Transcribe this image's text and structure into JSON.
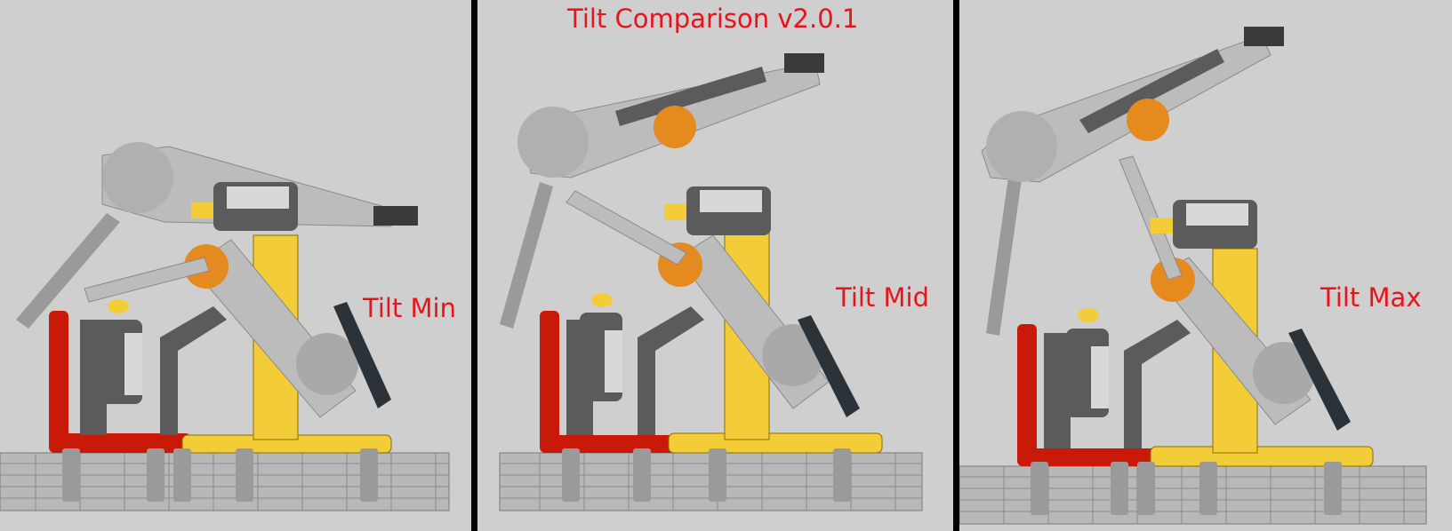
{
  "title": "Tilt Comparison v2.0.1",
  "panels": [
    {
      "label": "Tilt Min"
    },
    {
      "label": "Tilt Mid"
    },
    {
      "label": "Tilt Max"
    }
  ],
  "colors": {
    "background": "#cfcfcf",
    "label": "#e8141c",
    "divider": "#000000",
    "yellow_beam": "#f2cd37",
    "red_beam": "#c91a09",
    "light_gray": "#bcbcbc",
    "dark_gray": "#5b5b5b",
    "black_beam": "#2b3238",
    "orange": "#e58a1f"
  }
}
